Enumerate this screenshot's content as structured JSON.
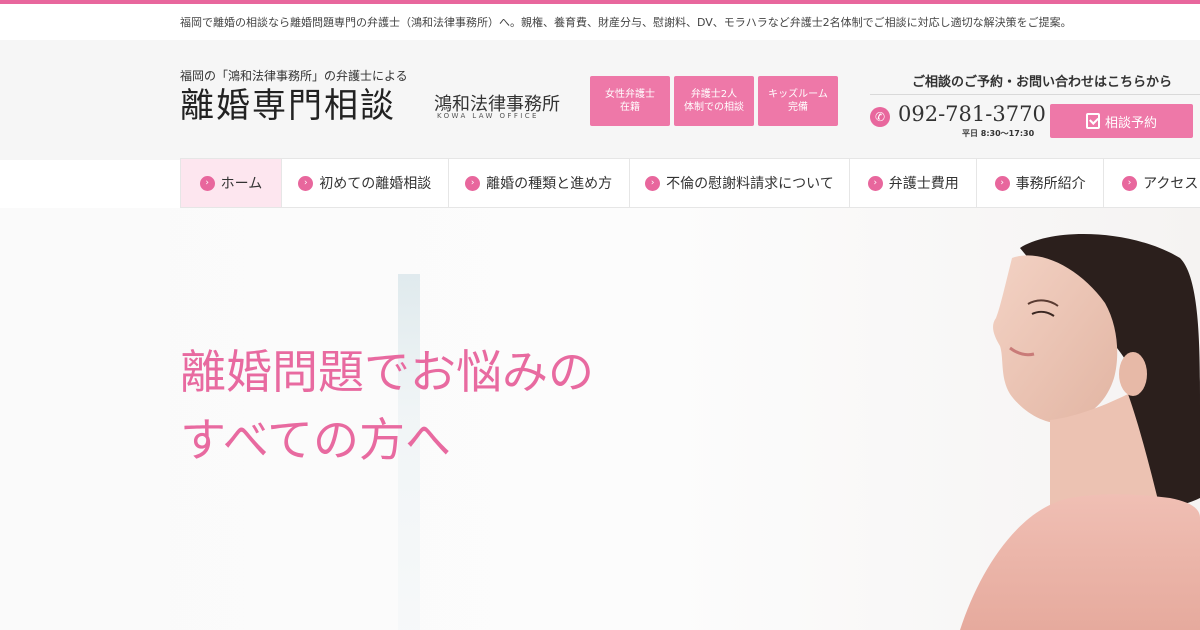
{
  "topbar": {
    "tagline": "福岡で離婚の相談なら離婚問題専門の弁護士（鴻和法律事務所）へ。親権、養育費、財産分与、慰謝料、DV、モラハラなど弁護士2名体制でご相談に対応し適切な解決策をご提案。"
  },
  "logo": {
    "sub": "福岡の「鴻和法律事務所」の弁護士による",
    "main": "離婚専門相談",
    "firm_name": "鴻和法律事務所",
    "firm_en": "KOWA LAW OFFICE"
  },
  "badges": [
    {
      "line1": "女性弁護士",
      "line2": "在籍"
    },
    {
      "line1": "弁護士2人",
      "line2": "体制での相談"
    },
    {
      "line1": "キッズルーム",
      "line2": "完備"
    }
  ],
  "contact": {
    "title": "ご相談のご予約・お問い合わせはこちらから",
    "phone": "092-781-3770",
    "hours": "平日 8:30～17:30",
    "reserve_label": "相談予約",
    "phone_icon": "phone-icon",
    "reserve_icon": "clipboard-check-icon"
  },
  "nav": {
    "items": [
      {
        "label": "ホーム",
        "active": true
      },
      {
        "label": "初めての離婚相談"
      },
      {
        "label": "離婚の種類と進め方"
      },
      {
        "label": "不倫の慰謝料請求について"
      },
      {
        "label": "弁護士費用"
      },
      {
        "label": "事務所紹介"
      },
      {
        "label": "アクセス"
      }
    ],
    "arrow_icon": "chevron-right-circle-icon"
  },
  "hero": {
    "line1": "離婚問題でお悩みの",
    "line2": "すべての方へ"
  },
  "colors": {
    "accent": "#e8679d",
    "badge": "#ee78a8",
    "nav_active": "#fde6ef",
    "hero_text": "#e86aa0"
  }
}
